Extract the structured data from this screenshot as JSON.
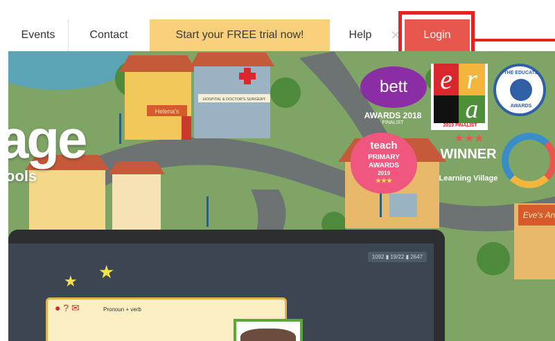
{
  "nav": {
    "items": [
      "Events",
      "Contact",
      "Start your FREE trial now!",
      "Help"
    ],
    "close_glyph": "✕",
    "login": "Login",
    "colors": {
      "trial_bg": "#f8d07a",
      "login_bg": "#e8574d",
      "highlight": "#e22421"
    }
  },
  "hero": {
    "title": "age",
    "subtitle": "ools",
    "badges": {
      "bett": {
        "name": "bett",
        "caption": "AWARDS 2018",
        "status": "FINALIST"
      },
      "era": {
        "letters": [
          "e",
          "r",
          "a"
        ],
        "year": "2019 FINALIST"
      },
      "educate": {
        "top": "THE EDUCATE",
        "bottom": "AWARDS"
      },
      "teach": {
        "line1": "teach",
        "line2": "PRIMARY",
        "line3": "AWARDS",
        "line4": "2019",
        "stars": "★★★"
      },
      "winner": {
        "stars": "★★★",
        "title": "WINNER",
        "subtitle": "Learning Village"
      }
    },
    "village_signs": {
      "shop": "Helena's",
      "hospital": "HOSPITAL & DOCTOR'S SURGERY",
      "corner_shop": "Eve's An"
    }
  },
  "laptop": {
    "toolbar": "1092  ▮  19/22  ▮  2647",
    "game_label": "Pronoun + verb",
    "game_icons": "● ? ✉"
  }
}
